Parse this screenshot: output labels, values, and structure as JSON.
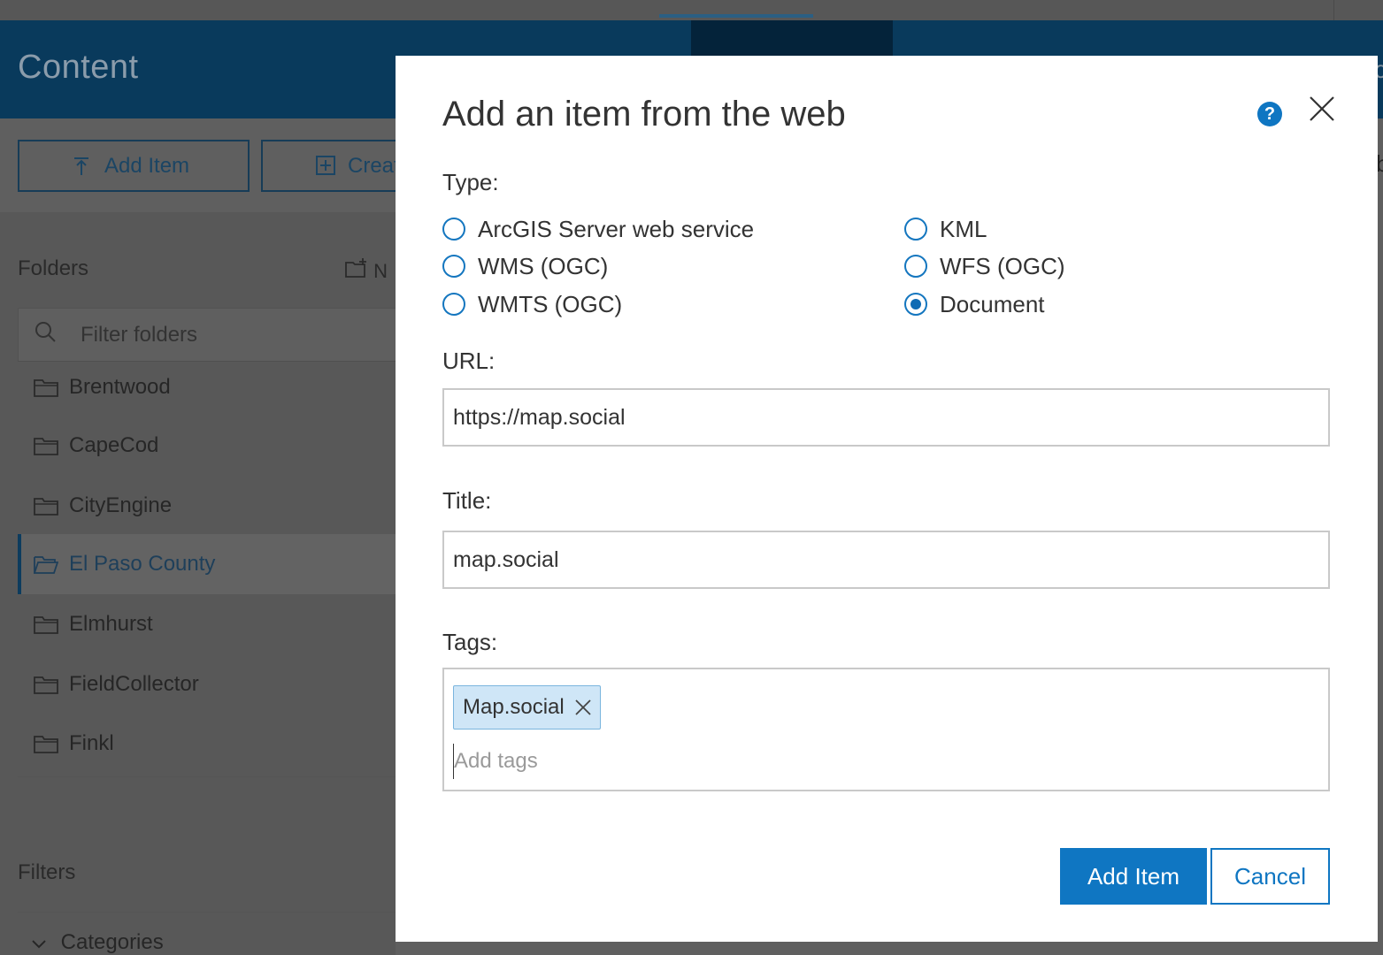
{
  "page": {
    "title": "Content"
  },
  "toolbar": {
    "add_item_label": "Add Item",
    "create_label": "Creat"
  },
  "folders": {
    "heading": "Folders",
    "new_label": "N",
    "filter_placeholder": "Filter folders",
    "items": [
      {
        "label": "Brentwood",
        "active": false
      },
      {
        "label": "CapeCod",
        "active": false
      },
      {
        "label": "CityEngine",
        "active": false
      },
      {
        "label": "El Paso County",
        "active": true
      },
      {
        "label": "Elmhurst",
        "active": false
      },
      {
        "label": "FieldCollector",
        "active": false
      },
      {
        "label": "Finkl",
        "active": false
      }
    ]
  },
  "filters": {
    "heading": "Filters",
    "categories_label": "Categories"
  },
  "modal": {
    "title": "Add an item from the web",
    "type_label": "Type:",
    "types": [
      {
        "label": "ArcGIS Server web service",
        "selected": false
      },
      {
        "label": "WMS (OGC)",
        "selected": false
      },
      {
        "label": "WMTS (OGC)",
        "selected": false
      },
      {
        "label": "KML",
        "selected": false
      },
      {
        "label": "WFS (OGC)",
        "selected": false
      },
      {
        "label": "Document",
        "selected": true
      }
    ],
    "url_label": "URL:",
    "url_value": "https://map.social",
    "title_label": "Title:",
    "title_value": "map.social",
    "tags_label": "Tags:",
    "tags": [
      "Map.social"
    ],
    "tags_placeholder": "Add tags",
    "primary_button": "Add Item",
    "cancel_button": "Cancel"
  },
  "colors": {
    "accent": "#0f76c2",
    "banner": "#093a5c",
    "overlay": "#5f5f5f",
    "chip_bg": "#cfe6f7"
  }
}
